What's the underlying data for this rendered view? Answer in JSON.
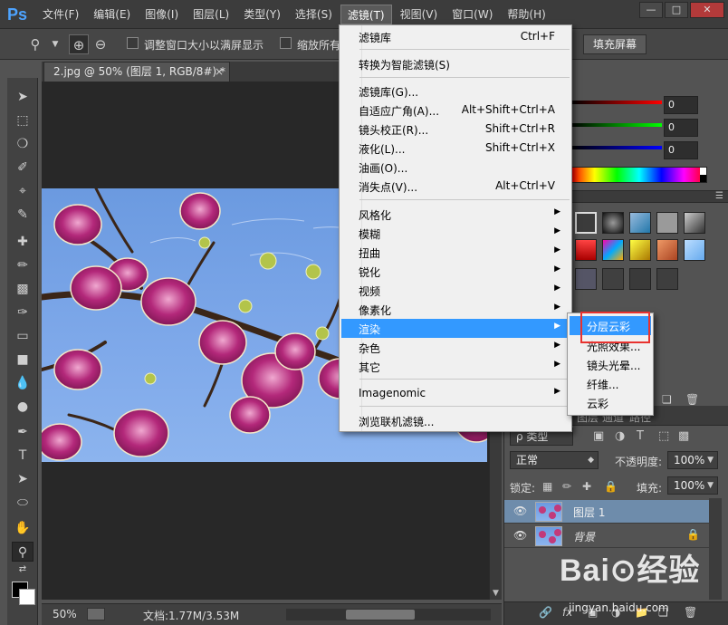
{
  "app": {
    "logo": "Ps",
    "menu": [
      "文件(F)",
      "编辑(E)",
      "图像(I)",
      "图层(L)",
      "类型(Y)",
      "选择(S)",
      "滤镜(T)",
      "视图(V)",
      "窗口(W)",
      "帮助(H)"
    ],
    "active_menu": "滤镜(T)",
    "window_controls": [
      "—",
      "□",
      "✕"
    ]
  },
  "options_bar": {
    "resize_window_label": "调整窗口大小以满屏显示",
    "zoom_all_label": "缩放所有",
    "fill_screen_button": "填充屏幕"
  },
  "document": {
    "tab_title": "2.jpg @ 50% (图层 1, RGB/8#) *",
    "tab_close": "×"
  },
  "status": {
    "zoom": "50%",
    "doc_info": "文档:1.77M/3.53M"
  },
  "color_panel": {
    "r": "0",
    "g": "0",
    "b": "0"
  },
  "filter_menu": {
    "items": [
      {
        "label": "滤镜库",
        "shortcut": "Ctrl+F"
      },
      {
        "label": "转换为智能滤镜(S)",
        "shortcut": ""
      },
      {
        "label": "滤镜库(G)...",
        "shortcut": ""
      },
      {
        "label": "自适应广角(A)...",
        "shortcut": "Alt+Shift+Ctrl+A"
      },
      {
        "label": "镜头校正(R)...",
        "shortcut": "Shift+Ctrl+R"
      },
      {
        "label": "液化(L)...",
        "shortcut": "Shift+Ctrl+X"
      },
      {
        "label": "油画(O)...",
        "shortcut": ""
      },
      {
        "label": "消失点(V)...",
        "shortcut": "Alt+Ctrl+V"
      },
      {
        "label": "风格化",
        "shortcut": ""
      },
      {
        "label": "模糊",
        "shortcut": ""
      },
      {
        "label": "扭曲",
        "shortcut": ""
      },
      {
        "label": "锐化",
        "shortcut": ""
      },
      {
        "label": "视频",
        "shortcut": ""
      },
      {
        "label": "像素化",
        "shortcut": ""
      },
      {
        "label": "渲染",
        "shortcut": ""
      },
      {
        "label": "杂色",
        "shortcut": ""
      },
      {
        "label": "其它",
        "shortcut": ""
      },
      {
        "label": "Imagenomic",
        "shortcut": ""
      },
      {
        "label": "浏览联机滤镜...",
        "shortcut": ""
      }
    ]
  },
  "render_submenu": {
    "items": [
      "分层云彩",
      "光照效果...",
      "镜头光晕...",
      "纤维...",
      "云彩"
    ]
  },
  "layers_panel": {
    "tabs": [
      "图层",
      "通道",
      "路径"
    ],
    "filter_kind": "ρ 类型",
    "blend_mode": "正常",
    "opacity_label": "不透明度:",
    "opacity_value": "100%",
    "lock_label": "锁定:",
    "fill_label": "填充:",
    "fill_value": "100%",
    "layers": [
      {
        "name": "图层 1",
        "selected": true
      },
      {
        "name": "背景",
        "selected": false,
        "locked": true
      }
    ]
  },
  "watermark": {
    "logo": "Bai⊙经验",
    "url": "jingyan.baidu.com"
  }
}
